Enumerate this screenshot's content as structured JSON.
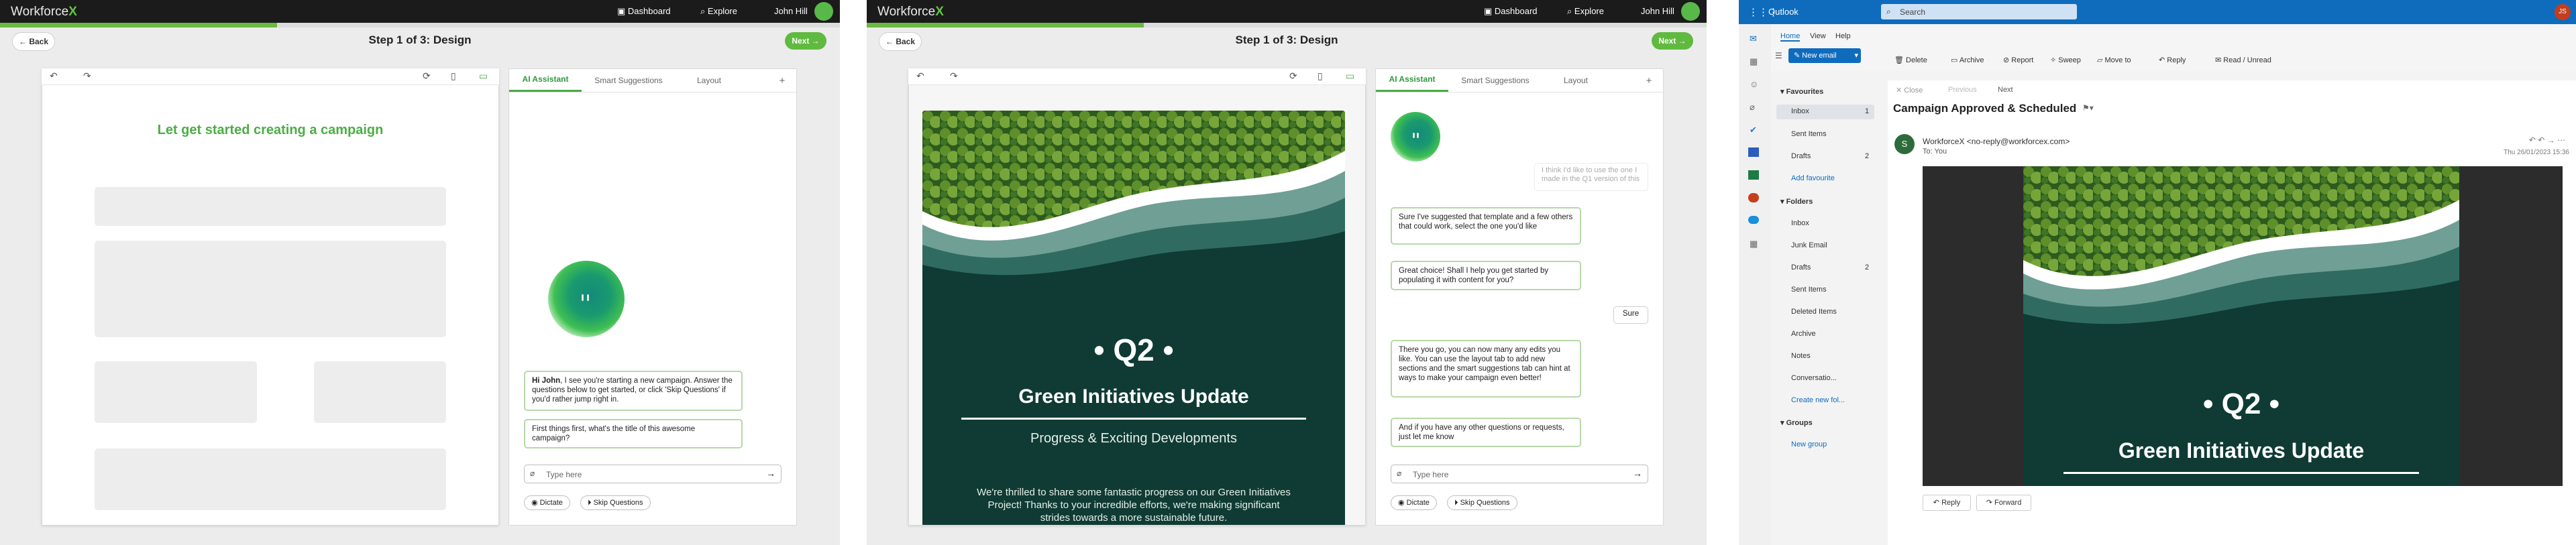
{
  "colors": {
    "accent_green": "#5fba3f",
    "outlook_blue": "#0f6cbd",
    "dark_bar": "#1b1b1b",
    "email_teal": "#0f3b34"
  },
  "app": {
    "logo_text": "Workforce",
    "logo_mark": "X",
    "nav": {
      "dashboard": "Dashboard",
      "explore": "Explore",
      "user": "John Hill"
    },
    "progress_fraction": 0.33,
    "back_label": "Back",
    "next_label": "Next",
    "step_title": "Step 1 of 3: Design",
    "tabs": [
      "AI Assistant",
      "Smart Suggestions",
      "Layout"
    ],
    "add_tab_icon": "+",
    "composer_placeholder": "Type here",
    "dictate_label": "Dictate",
    "skip_label": "Skip Questions"
  },
  "screen1": {
    "canvas_heading": "Let get started creating a campaign",
    "greeting_name": "Hi John",
    "greeting_rest": ", I see you're starting a new campaign. Answer the questions below to get started, or click 'Skip Questions' if you'd rather jump right in.",
    "question": "First things first, what's the title of this awesome campaign?"
  },
  "screen2": {
    "faded_user_msg": "I think I'd like to use the one I made in the Q1 version of this",
    "messages": [
      "Sure I've suggested that template and a few others that could work, select the one you'd like",
      "Great choice! Shall I help you get started by populating it with content for you?",
      "There you go, you can now many any edits you like. You can use the layout tab to add new sections and the smart suggestions tab can hint at ways to make your campaign even better!",
      "And if you have any other questions or requests, just let me know"
    ],
    "user_reply": "Sure",
    "email": {
      "quarter": "Q2",
      "title": "Green Initiatives Update",
      "subtitle": "Progress & Exciting Developments",
      "body": "We're thrilled to share some fantastic progress on our Green Initiatives Project! Thanks to your incredible efforts, we're making significant strides towards a more sustainable future."
    }
  },
  "outlook": {
    "app_name": "Outlook",
    "search_placeholder": "Search",
    "user_initials": "JS",
    "menu_tabs": [
      "Home",
      "View",
      "Help"
    ],
    "new_email": "New email",
    "ribbon": [
      "Delete",
      "Archive",
      "Report",
      "Sweep",
      "Move to",
      "Reply",
      "Read / Unread"
    ],
    "favourites_label": "Favourites",
    "favourites": [
      {
        "name": "Inbox",
        "count": "1"
      },
      {
        "name": "Sent Items",
        "count": ""
      },
      {
        "name": "Drafts",
        "count": "2"
      }
    ],
    "add_favourite": "Add favourite",
    "folders_label": "Folders",
    "folders": [
      {
        "name": "Inbox",
        "count": ""
      },
      {
        "name": "Junk Email",
        "count": ""
      },
      {
        "name": "Drafts",
        "count": "2"
      },
      {
        "name": "Sent Items",
        "count": ""
      },
      {
        "name": "Deleted Items",
        "count": ""
      },
      {
        "name": "Archive",
        "count": ""
      },
      {
        "name": "Notes",
        "count": ""
      },
      {
        "name": "Conversatio...",
        "count": ""
      }
    ],
    "create_folder": "Create new fol...",
    "groups_label": "Groups",
    "new_group": "New group",
    "close": "Close",
    "previous": "Previous",
    "next": "Next",
    "subject": "Campaign Approved & Scheduled",
    "sender": "WorkforceX <no-reply@workforcex.com>",
    "sender_initial": "S",
    "to": "To: You",
    "date": "Thu 26/01/2023 15:36",
    "reply": "Reply",
    "forward": "Forward"
  }
}
